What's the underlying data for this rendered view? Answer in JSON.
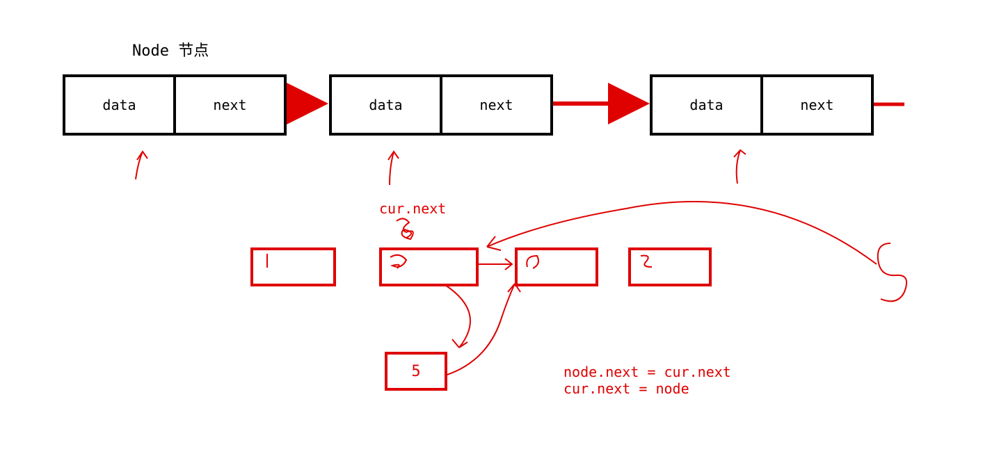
{
  "title": "Node 节点",
  "node_cell": {
    "data": "data",
    "next": "next"
  },
  "annotations": {
    "cur_next": "cur.next",
    "code1": "node.next = cur.next",
    "code2": "cur.next = node"
  },
  "small_values": {
    "a": "1",
    "b": "2",
    "c": "9",
    "d": "6",
    "e": "5",
    "f": "5"
  },
  "colors": {
    "stroke_black": "#000000",
    "accent_red": "#df0000"
  }
}
